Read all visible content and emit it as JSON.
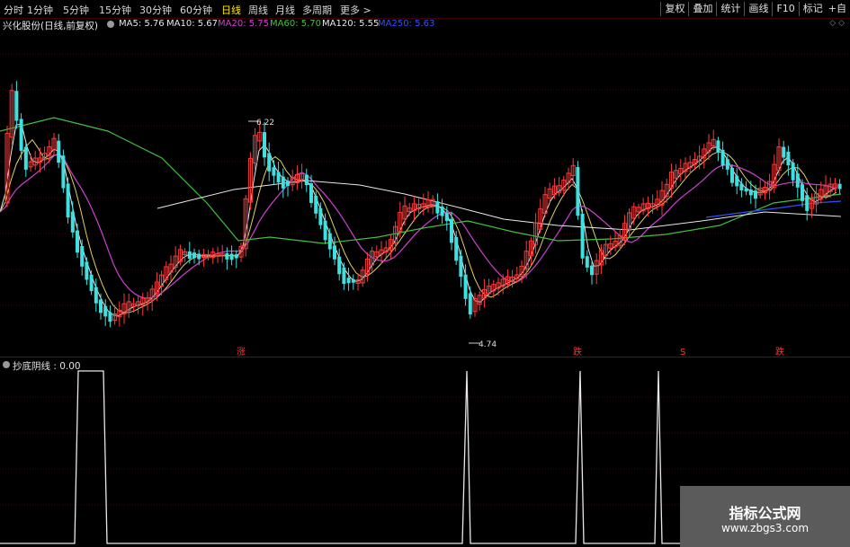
{
  "toolbar": {
    "periods": [
      "分时",
      "1分钟",
      "5分钟",
      "15分钟",
      "30分钟",
      "60分钟",
      "日线",
      "周线",
      "月线",
      "多周期",
      "更多 >"
    ],
    "active_period": "日线",
    "right_buttons": [
      "复权",
      "叠加",
      "统计",
      "画线",
      "F10",
      "标记",
      "+自"
    ]
  },
  "info": {
    "stock_title": "兴化股份(日线,前复权)",
    "ma": [
      {
        "label": "MA5: 5.76",
        "color": "#e8e8e8"
      },
      {
        "label": "MA10: 5.67",
        "color": "#e8e8e8"
      },
      {
        "label": "MA20: 5.75",
        "color": "#d040d0"
      },
      {
        "label": "MA60: 5.70",
        "color": "#40c040"
      },
      {
        "label": "MA120: 5.55",
        "color": "#e8e8e8"
      },
      {
        "label": "MA250: 5.63",
        "color": "#3050ff"
      }
    ]
  },
  "annotations": {
    "high_label": "6.22",
    "low_label": "4.74",
    "signals": [
      "涨",
      "跌",
      "S",
      "跌"
    ]
  },
  "lower_panel": {
    "indicator_label": "抄底阴线 : 0.00"
  },
  "watermark": {
    "line1": "指标公式网",
    "line2": "www.zbgs3.com"
  },
  "colors": {
    "up": "#ff3a3a",
    "down": "#40e0e0",
    "active": "#ffea00",
    "grid": "#5a0000"
  }
}
